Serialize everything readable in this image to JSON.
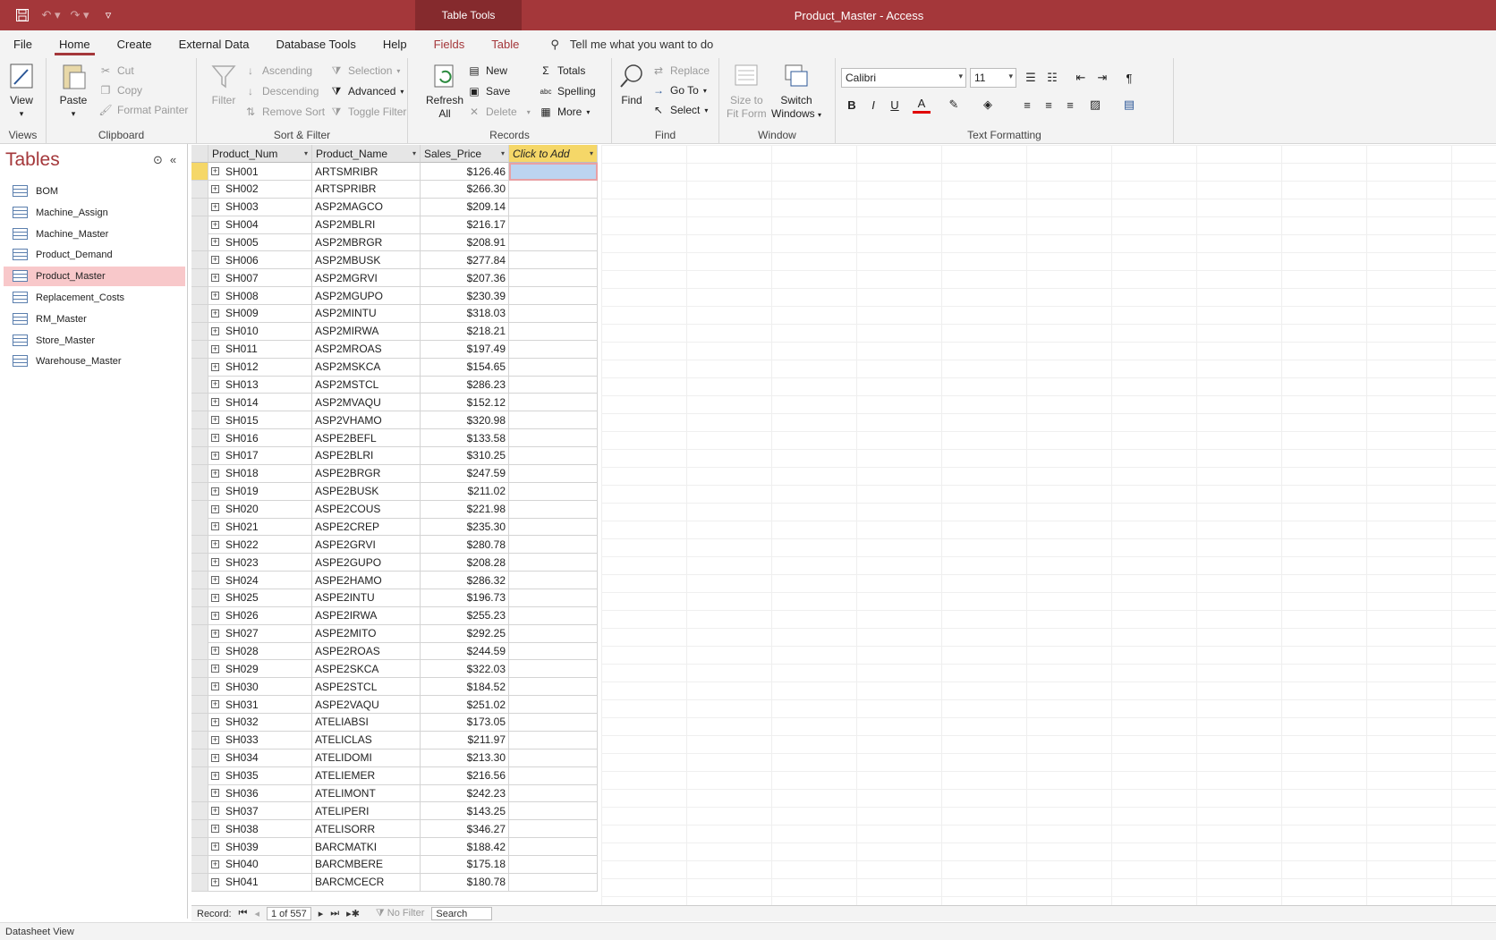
{
  "window": {
    "title": "Product_Master  -  Access",
    "context_tab": "Table Tools"
  },
  "tabs": [
    "File",
    "Home",
    "Create",
    "External Data",
    "Database Tools",
    "Help",
    "Fields",
    "Table"
  ],
  "tell_me": "Tell me what you want to do",
  "ribbon": {
    "views": {
      "label": "Views",
      "view": "View"
    },
    "clipboard": {
      "label": "Clipboard",
      "paste": "Paste",
      "cut": "Cut",
      "copy": "Copy",
      "format_painter": "Format Painter"
    },
    "sort_filter": {
      "label": "Sort & Filter",
      "filter": "Filter",
      "ascending": "Ascending",
      "descending": "Descending",
      "remove_sort": "Remove Sort",
      "selection": "Selection",
      "advanced": "Advanced",
      "toggle_filter": "Toggle Filter"
    },
    "records": {
      "label": "Records",
      "refresh": "Refresh",
      "refresh_sub": "All",
      "new": "New",
      "save": "Save",
      "delete": "Delete",
      "totals": "Totals",
      "spelling": "Spelling",
      "more": "More"
    },
    "find": {
      "label": "Find",
      "find": "Find",
      "replace": "Replace",
      "goto": "Go To",
      "select": "Select"
    },
    "window": {
      "label": "Window",
      "size_to_fit": "Size to",
      "size_to_fit2": "Fit Form",
      "switch": "Switch",
      "switch2": "Windows"
    },
    "text_formatting": {
      "label": "Text Formatting",
      "font": "Calibri",
      "size": "11"
    }
  },
  "nav": {
    "title": "Tables",
    "items": [
      "BOM",
      "Machine_Assign",
      "Machine_Master",
      "Product_Demand",
      "Product_Master",
      "Replacement_Costs",
      "RM_Master",
      "Store_Master",
      "Warehouse_Master"
    ],
    "selected": "Product_Master"
  },
  "table": {
    "columns": [
      "Product_Num",
      "Product_Name",
      "Sales_Price",
      "Click to Add"
    ],
    "rows": [
      [
        "SH001",
        "ARTSMRIBR",
        "$126.46"
      ],
      [
        "SH002",
        "ARTSPRIBR",
        "$266.30"
      ],
      [
        "SH003",
        "ASP2MAGCO",
        "$209.14"
      ],
      [
        "SH004",
        "ASP2MBLRI",
        "$216.17"
      ],
      [
        "SH005",
        "ASP2MBRGR",
        "$208.91"
      ],
      [
        "SH006",
        "ASP2MBUSK",
        "$277.84"
      ],
      [
        "SH007",
        "ASP2MGRVI",
        "$207.36"
      ],
      [
        "SH008",
        "ASP2MGUPO",
        "$230.39"
      ],
      [
        "SH009",
        "ASP2MINTU",
        "$318.03"
      ],
      [
        "SH010",
        "ASP2MIRWA",
        "$218.21"
      ],
      [
        "SH011",
        "ASP2MROAS",
        "$197.49"
      ],
      [
        "SH012",
        "ASP2MSKCA",
        "$154.65"
      ],
      [
        "SH013",
        "ASP2MSTCL",
        "$286.23"
      ],
      [
        "SH014",
        "ASP2MVAQU",
        "$152.12"
      ],
      [
        "SH015",
        "ASP2VHAMO",
        "$320.98"
      ],
      [
        "SH016",
        "ASPE2BEFL",
        "$133.58"
      ],
      [
        "SH017",
        "ASPE2BLRI",
        "$310.25"
      ],
      [
        "SH018",
        "ASPE2BRGR",
        "$247.59"
      ],
      [
        "SH019",
        "ASPE2BUSK",
        "$211.02"
      ],
      [
        "SH020",
        "ASPE2COUS",
        "$221.98"
      ],
      [
        "SH021",
        "ASPE2CREP",
        "$235.30"
      ],
      [
        "SH022",
        "ASPE2GRVI",
        "$280.78"
      ],
      [
        "SH023",
        "ASPE2GUPO",
        "$208.28"
      ],
      [
        "SH024",
        "ASPE2HAMO",
        "$286.32"
      ],
      [
        "SH025",
        "ASPE2INTU",
        "$196.73"
      ],
      [
        "SH026",
        "ASPE2IRWA",
        "$255.23"
      ],
      [
        "SH027",
        "ASPE2MITO",
        "$292.25"
      ],
      [
        "SH028",
        "ASPE2ROAS",
        "$244.59"
      ],
      [
        "SH029",
        "ASPE2SKCA",
        "$322.03"
      ],
      [
        "SH030",
        "ASPE2STCL",
        "$184.52"
      ],
      [
        "SH031",
        "ASPE2VAQU",
        "$251.02"
      ],
      [
        "SH032",
        "ATELIABSI",
        "$173.05"
      ],
      [
        "SH033",
        "ATELICLAS",
        "$211.97"
      ],
      [
        "SH034",
        "ATELIDOMI",
        "$213.30"
      ],
      [
        "SH035",
        "ATELIEMER",
        "$216.56"
      ],
      [
        "SH036",
        "ATELIMONT",
        "$242.23"
      ],
      [
        "SH037",
        "ATELIPERI",
        "$143.25"
      ],
      [
        "SH038",
        "ATELISORR",
        "$346.27"
      ],
      [
        "SH039",
        "BARCMATKI",
        "$188.42"
      ],
      [
        "SH040",
        "BARCMBERE",
        "$175.18"
      ],
      [
        "SH041",
        "BARCMCECR",
        "$180.78"
      ]
    ]
  },
  "record_nav": {
    "label": "Record:",
    "position": "1 of 557",
    "no_filter": "No Filter",
    "search": "Search"
  },
  "status": "Datasheet View",
  "colors": {
    "accent": "#a4373a",
    "selected_nav": "#f8c8ca",
    "click_to_add": "#f5d768"
  }
}
